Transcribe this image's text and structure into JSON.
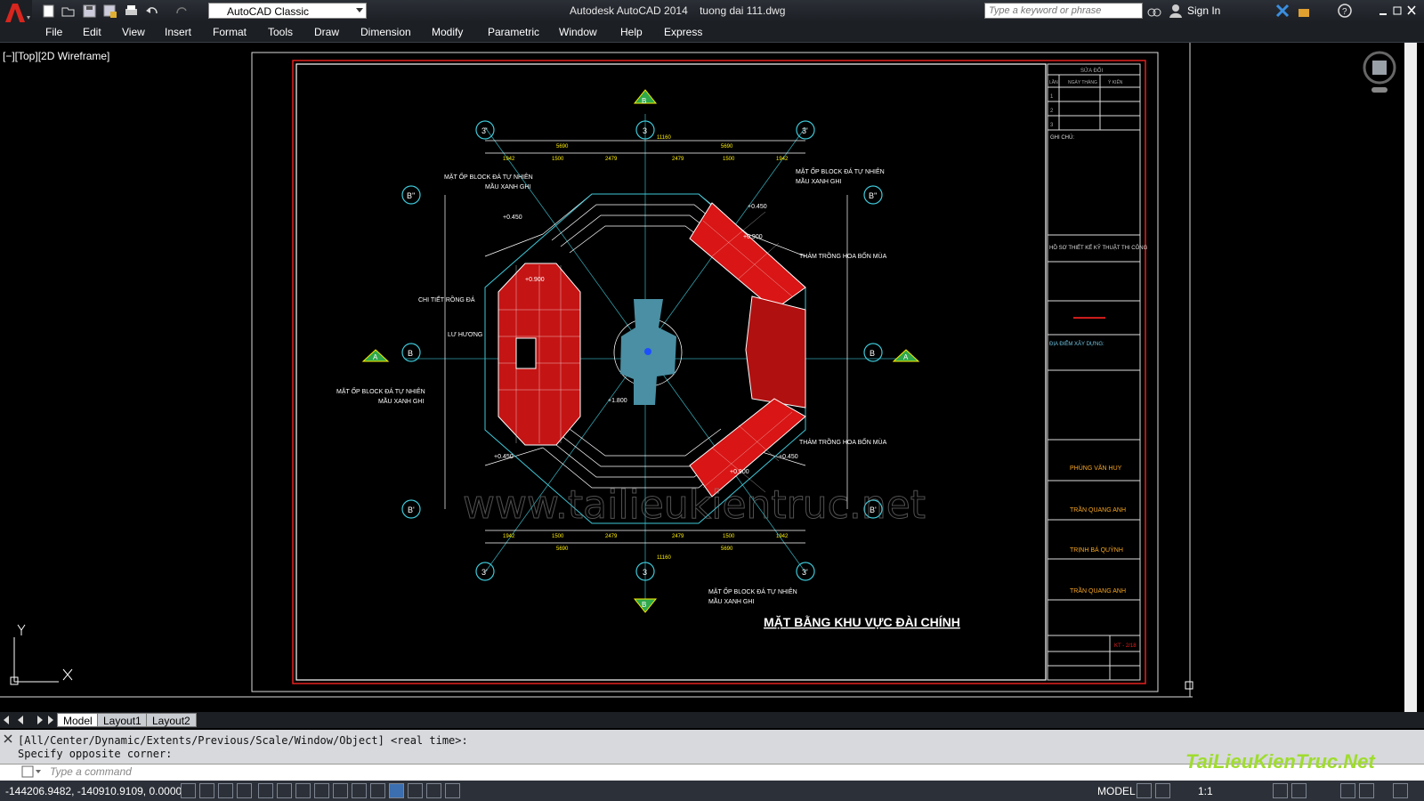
{
  "app": {
    "title": "Autodesk AutoCAD 2014    tuong dai 111.dwg",
    "workspace": "AutoCAD Classic",
    "search_placeholder": "Type a keyword or phrase",
    "sign_in": "Sign In"
  },
  "menu": [
    "File",
    "Edit",
    "View",
    "Insert",
    "Format",
    "Tools",
    "Draw",
    "Dimension",
    "Modify",
    "Parametric",
    "Window",
    "Help",
    "Express"
  ],
  "viewport": {
    "label": "[−][Top][2D Wireframe]"
  },
  "drawing": {
    "main_title": "MẶT BẰNG KHU VỰC ĐÀI CHÍNH",
    "watermark": "www.tailieukientruc.net",
    "notes": [
      "MẶT ỐP BLOCK ĐÁ TỰ NHIÊN",
      "MẦU XANH GHI",
      "THẢM TRỒNG HOA BỐN MÙA",
      "CHI TIẾT RỒNG ĐÁ",
      "LƯ HƯƠNG"
    ],
    "levels": [
      "+0.450",
      "+0.900",
      "+1.800"
    ],
    "dims_top": [
      "1942",
      "1500",
      "2479",
      "2479",
      "1500",
      "1942"
    ],
    "dims_top_groups": [
      "5690",
      "11160",
      "5690"
    ],
    "grid_labels": [
      "3'",
      "3",
      "3'",
      "B''",
      "B",
      "B'",
      "A",
      "B"
    ],
    "titleblock": {
      "revision_header": "SỬA ĐỔI",
      "revision_cols": [
        "LẦN",
        "NGÀY THÁNG",
        "Ý KIẾN"
      ],
      "revision_rows": [
        "1",
        "2",
        "3"
      ],
      "note": "GHI CHÚ:",
      "project": "HỒ SƠ THIẾT KẾ KỸ THUẬT THI CÔNG",
      "location": "ĐỊA ĐIỂM XÂY DỰNG:",
      "names": [
        "PHÙNG VĂN HUY",
        "TRẦN QUANG ANH",
        "TRỊNH BÁ QUỲNH",
        "TRẦN QUANG ANH"
      ],
      "drawing_no": "KT - 2/18"
    }
  },
  "tabs": [
    "Model",
    "Layout1",
    "Layout2"
  ],
  "command": {
    "history": [
      "[All/Center/Dynamic/Extents/Previous/Scale/Window/Object] <real time>:",
      "Specify opposite corner:"
    ],
    "placeholder": "Type  a  command"
  },
  "status": {
    "coords": "-144206.9482, -140910.9109, 0.0000",
    "model": "MODEL",
    "scale": "1:1"
  },
  "site_watermark": "TaiLieuKienTruc.Net",
  "colors": {
    "accent_red": "#e4201f",
    "cyan": "#3ec8d8",
    "yellow": "#ffee00",
    "statue": "#4a8fa3"
  }
}
